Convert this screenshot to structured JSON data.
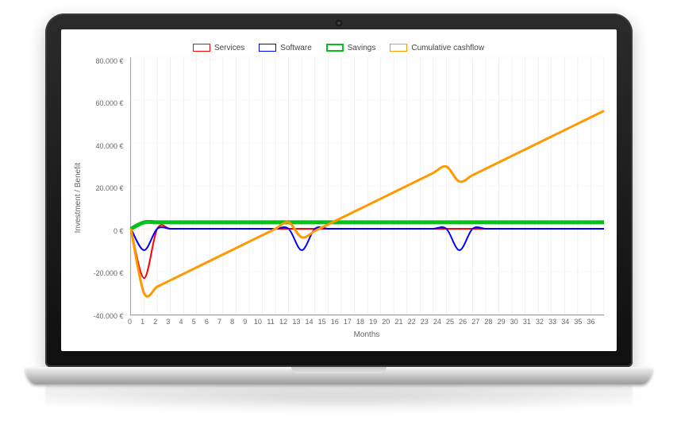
{
  "legend": {
    "services": "Services",
    "software": "Software",
    "savings": "Savings",
    "cumulative": "Cumulative cashflow"
  },
  "axes": {
    "ylabel": "Investment / Benefit",
    "xlabel": "Months"
  },
  "colors": {
    "services": "#ff0000",
    "software": "#0000ff",
    "savings": "#00c31a",
    "cumulative": "#ff9900"
  },
  "chart_data": {
    "type": "line",
    "xlabel": "Months",
    "ylabel": "Investment / Benefit",
    "xlim": [
      0,
      36
    ],
    "ylim": [
      -40000,
      80000
    ],
    "xticks": [
      0,
      1,
      2,
      3,
      4,
      5,
      6,
      7,
      8,
      9,
      10,
      11,
      12,
      13,
      14,
      15,
      16,
      17,
      18,
      19,
      20,
      21,
      22,
      23,
      24,
      25,
      26,
      27,
      28,
      29,
      30,
      31,
      32,
      33,
      34,
      35,
      36
    ],
    "yticks": [
      -40000,
      -20000,
      0,
      20000,
      40000,
      60000,
      80000
    ],
    "ytick_labels": [
      "-40.000 €",
      "-20.000 €",
      "0 €",
      "20.000 €",
      "40.000 €",
      "60.000 €",
      "80.000 €"
    ],
    "currency": "€",
    "series": [
      {
        "name": "Services",
        "color": "#ff0000",
        "x": [
          0,
          1,
          2,
          3,
          4,
          5,
          6,
          7,
          8,
          9,
          10,
          11,
          12,
          13,
          14,
          15,
          16,
          17,
          18,
          19,
          20,
          21,
          22,
          23,
          24,
          25,
          26,
          27,
          28,
          29,
          30,
          31,
          32,
          33,
          34,
          35,
          36
        ],
        "y": [
          0,
          -23000,
          0,
          0,
          0,
          0,
          0,
          0,
          0,
          0,
          0,
          0,
          0,
          0,
          0,
          0,
          0,
          0,
          0,
          0,
          0,
          0,
          0,
          0,
          0,
          0,
          0,
          0,
          0,
          0,
          0,
          0,
          0,
          0,
          0,
          0,
          0
        ]
      },
      {
        "name": "Software",
        "color": "#0000ff",
        "x": [
          0,
          1,
          2,
          3,
          4,
          5,
          6,
          7,
          8,
          9,
          10,
          11,
          12,
          13,
          14,
          15,
          16,
          17,
          18,
          19,
          20,
          21,
          22,
          23,
          24,
          25,
          26,
          27,
          28,
          29,
          30,
          31,
          32,
          33,
          34,
          35,
          36
        ],
        "y": [
          0,
          -10000,
          0,
          0,
          0,
          0,
          0,
          0,
          0,
          0,
          0,
          0,
          0,
          -10000,
          0,
          0,
          0,
          0,
          0,
          0,
          0,
          0,
          0,
          0,
          0,
          -10000,
          0,
          0,
          0,
          0,
          0,
          0,
          0,
          0,
          0,
          0,
          0
        ]
      },
      {
        "name": "Savings",
        "color": "#00c31a",
        "x": [
          0,
          1,
          2,
          3,
          4,
          5,
          6,
          7,
          8,
          9,
          10,
          11,
          12,
          13,
          14,
          15,
          16,
          17,
          18,
          19,
          20,
          21,
          22,
          23,
          24,
          25,
          26,
          27,
          28,
          29,
          30,
          31,
          32,
          33,
          34,
          35,
          36
        ],
        "y": [
          0,
          3000,
          3000,
          3000,
          3000,
          3000,
          3000,
          3000,
          3000,
          3000,
          3000,
          3000,
          3000,
          3000,
          3000,
          3000,
          3000,
          3000,
          3000,
          3000,
          3000,
          3000,
          3000,
          3000,
          3000,
          3000,
          3000,
          3000,
          3000,
          3000,
          3000,
          3000,
          3000,
          3000,
          3000,
          3000,
          3000
        ]
      },
      {
        "name": "Cumulative cashflow",
        "color": "#ff9900",
        "x": [
          0,
          1,
          2,
          3,
          4,
          5,
          6,
          7,
          8,
          9,
          10,
          11,
          12,
          13,
          14,
          15,
          16,
          17,
          18,
          19,
          20,
          21,
          22,
          23,
          24,
          25,
          26,
          27,
          28,
          29,
          30,
          31,
          32,
          33,
          34,
          35,
          36
        ],
        "y": [
          0,
          -30000,
          -27000,
          -24000,
          -21000,
          -18000,
          -15000,
          -12000,
          -9000,
          -6000,
          -3000,
          0,
          3000,
          -4000,
          -1000,
          2000,
          5000,
          8000,
          11000,
          14000,
          17000,
          20000,
          23000,
          26000,
          29000,
          22000,
          25000,
          28000,
          31000,
          34000,
          37000,
          40000,
          43000,
          46000,
          49000,
          52000,
          55000
        ]
      }
    ]
  }
}
